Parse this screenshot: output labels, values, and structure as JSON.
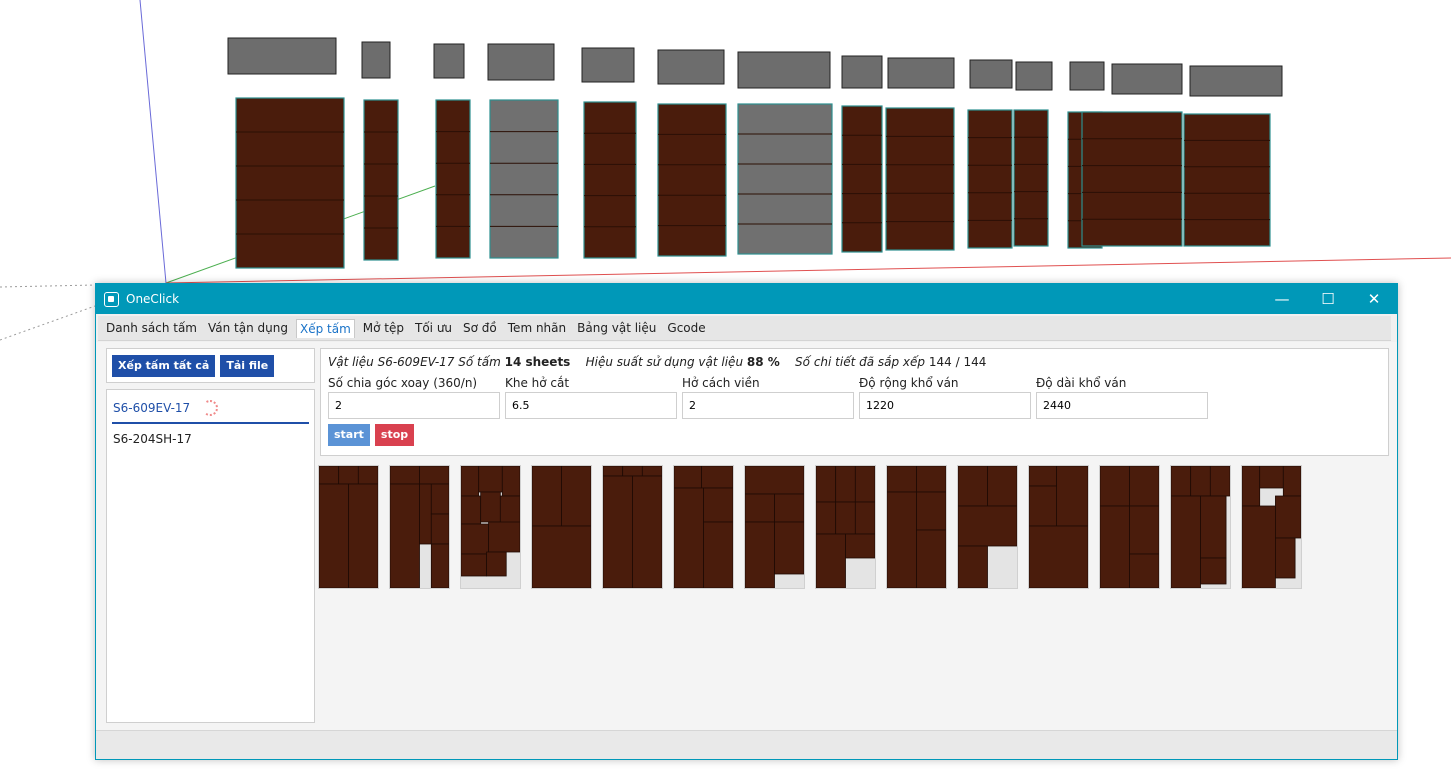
{
  "window": {
    "title": "OneClick",
    "minimize_symbol": "—",
    "maximize_symbol": "☐",
    "close_symbol": "✕"
  },
  "menu": [
    {
      "label": "Danh sách tấm"
    },
    {
      "label": "Ván tận dụng"
    },
    {
      "label": "Xếp tấm",
      "active": true
    },
    {
      "label": "Mở tệp"
    },
    {
      "label": "Tối ưu"
    },
    {
      "label": "Sơ đồ"
    },
    {
      "label": "Tem nhãn"
    },
    {
      "label": "Bảng vật liệu"
    },
    {
      "label": "Gcode"
    }
  ],
  "left_panel": {
    "arrange_all_label": "Xếp tấm tất cả",
    "load_file_label": "Tải file",
    "materials": [
      {
        "name": "S6-609EV-17",
        "selected": true
      },
      {
        "name": "S6-204SH-17",
        "selected": false
      }
    ]
  },
  "summary": {
    "material_label": "Vật liệu",
    "material_value": "S6-609EV-17",
    "sheet_count_label": "Số tấm",
    "sheet_count_value": "14 sheets",
    "efficiency_label": "Hiệu suất sử dụng vật liệu",
    "efficiency_value": "88 %",
    "placed_label": "Số chi tiết đã sắp xếp",
    "placed_value": "144 / 144"
  },
  "fields": [
    {
      "label": "Số chia góc xoay (360/n)",
      "value": "2"
    },
    {
      "label": "Khe hở cắt",
      "value": "6.5"
    },
    {
      "label": "Hở cách viền",
      "value": "2"
    },
    {
      "label": "Độ rộng khổ ván",
      "value": "1220"
    },
    {
      "label": "Độ dài khổ ván",
      "value": "2440"
    }
  ],
  "actions": {
    "start_label": "start",
    "stop_label": "stop"
  },
  "colors": {
    "accent": "#0098b8",
    "primary_button": "#1f4fa8",
    "start_button": "#5b93d6",
    "stop_button": "#d9414f",
    "wood": "#4a1c0c",
    "sheet_background": "#e4e4e4"
  },
  "sheet_count": 14
}
